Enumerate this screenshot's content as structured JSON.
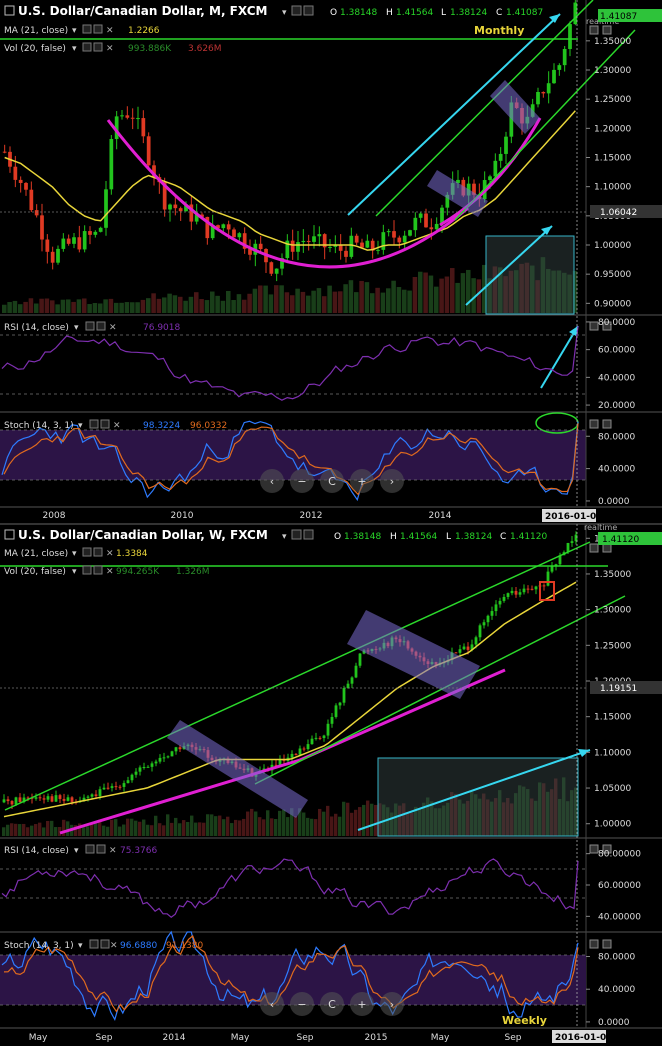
{
  "colors": {
    "background": "#000000",
    "bull": "#22c41d",
    "bear": "#e03a23",
    "ma": "#e8d53a",
    "rsi": "#7e2fb0",
    "stoch_k": "#2e7bff",
    "stoch_d": "#e06a1e",
    "magenta": "#e01fd2",
    "cyan": "#36d7f0",
    "channel": "#2bd82b",
    "box": "#7a6bd0",
    "panel_purple": "#2c1446",
    "price_tag": "#2ec33a"
  },
  "monthly": {
    "header": {
      "title": "U.S. Dollar/Canadian Dollar, M, FXCM",
      "o_label": "O",
      "o": "1.38148",
      "h_label": "H",
      "h": "1.41564",
      "l_label": "L",
      "l": "1.38124",
      "c_label": "C",
      "c": "1.41087"
    },
    "ma_label": "MA (21, close)",
    "ma_value": "1.2266",
    "vol_label": "Vol (20, false)",
    "vol_v1": "993.886K",
    "vol_v2": "3.626M",
    "annotation": "Monthly",
    "realtime": "realtime",
    "price_axis": [
      "1.40000",
      "1.35000",
      "1.30000",
      "1.25000",
      "1.20000",
      "1.15000",
      "1.10000",
      "1.05000",
      "1.00000",
      "0.95000",
      "0.90000"
    ],
    "price_tag": "1.41087",
    "crosshair_tag": "1.06042",
    "rsi_label": "RSI (14, close)",
    "rsi_value": "76.9018",
    "rsi_axis": [
      "80.0000",
      "60.0000",
      "40.0000",
      "20.0000"
    ],
    "stoch_label": "Stoch (14, 3, 1)",
    "stoch_k": "98.3224",
    "stoch_d": "96.0332",
    "stoch_axis": [
      "80.0000",
      "40.0000",
      "0.0000"
    ],
    "time_axis": [
      "2008",
      "2010",
      "2012",
      "2014"
    ],
    "date_tag": "2016-01-01"
  },
  "weekly": {
    "header": {
      "title": "U.S. Dollar/Canadian Dollar, W, FXCM",
      "o_label": "O",
      "o": "1.38148",
      "h_label": "H",
      "h": "1.41564",
      "l_label": "L",
      "l": "1.38124",
      "c_label": "C",
      "c": "1.41120"
    },
    "ma_label": "MA (21, close)",
    "ma_value": "1.3384",
    "vol_label": "Vol (20, false)",
    "vol_v1": "994.265K",
    "vol_v2": "1.326M",
    "annotation": "Weekly",
    "realtime": "realtime",
    "price_axis": [
      "1.40000",
      "1.35000",
      "1.30000",
      "1.25000",
      "1.20000",
      "1.15000",
      "1.10000",
      "1.05000",
      "1.00000"
    ],
    "price_tag": "1.41120",
    "crosshair_tag": "1.19151",
    "rsi_label": "RSI (14, close)",
    "rsi_value": "75.3766",
    "rsi_axis": [
      "80.00000",
      "60.00000",
      "40.00000"
    ],
    "stoch_label": "Stoch (14, 3, 1)",
    "stoch_k": "96.6880",
    "stoch_d": "91.1380",
    "stoch_axis": [
      "80.0000",
      "40.0000",
      "0.0000"
    ],
    "time_axis": [
      "May",
      "Sep",
      "2014",
      "May",
      "Sep",
      "2015",
      "May",
      "Sep"
    ],
    "date_tag": "2016-01-04"
  },
  "nav_buttons": [
    "‹",
    "−",
    "C",
    "+",
    "›"
  ],
  "chart_data": [
    {
      "type": "candlestick",
      "title": "U.S. Dollar/Canadian Dollar, M, FXCM",
      "xlabel": "",
      "ylabel": "",
      "ylim": [
        0.88,
        1.42
      ],
      "x": [
        "2007-01",
        "2007-04",
        "2007-07",
        "2007-10",
        "2008-01",
        "2008-04",
        "2008-07",
        "2008-10",
        "2009-01",
        "2009-04",
        "2009-07",
        "2009-10",
        "2010-01",
        "2010-04",
        "2010-07",
        "2010-10",
        "2011-01",
        "2011-04",
        "2011-07",
        "2011-10",
        "2012-01",
        "2012-04",
        "2012-07",
        "2012-10",
        "2013-01",
        "2013-04",
        "2013-07",
        "2013-10",
        "2014-01",
        "2014-04",
        "2014-07",
        "2014-10",
        "2015-01",
        "2015-04",
        "2015-07",
        "2015-10",
        "2015-12"
      ],
      "series": [
        {
          "name": "Close",
          "values": [
            1.16,
            1.11,
            1.05,
            0.98,
            1.0,
            1.01,
            1.02,
            1.22,
            1.23,
            1.16,
            1.08,
            1.06,
            1.05,
            1.02,
            1.04,
            1.01,
            0.99,
            0.96,
            1.0,
            1.01,
            1.0,
            0.99,
            1.0,
            0.99,
            1.01,
            1.02,
            1.04,
            1.04,
            1.09,
            1.1,
            1.09,
            1.13,
            1.24,
            1.21,
            1.27,
            1.31,
            1.41
          ]
        },
        {
          "name": "MA (21, close)",
          "values": [
            1.15,
            1.14,
            1.12,
            1.1,
            1.07,
            1.05,
            1.04,
            1.07,
            1.1,
            1.12,
            1.11,
            1.1,
            1.08,
            1.06,
            1.05,
            1.04,
            1.02,
            1.01,
            1.0,
            1.0,
            1.0,
            1.0,
            1.0,
            0.99,
            1.0,
            1.0,
            1.01,
            1.02,
            1.03,
            1.05,
            1.06,
            1.08,
            1.11,
            1.14,
            1.17,
            1.2,
            1.23
          ]
        }
      ],
      "indicators": {
        "rsi": 76.9018,
        "stoch_k": 98.3224,
        "stoch_d": 96.0332,
        "ma_last": 1.2266
      },
      "highlight_levels": [
        1.3717,
        1.06042
      ]
    },
    {
      "type": "candlestick",
      "title": "U.S. Dollar/Canadian Dollar, W, FXCM",
      "xlabel": "",
      "ylabel": "",
      "ylim": [
        0.98,
        1.42
      ],
      "x": [
        "2013-05",
        "2013-07",
        "2013-09",
        "2013-11",
        "2014-01",
        "2014-03",
        "2014-05",
        "2014-07",
        "2014-09",
        "2014-11",
        "2015-01",
        "2015-03",
        "2015-05",
        "2015-07",
        "2015-09",
        "2015-11",
        "2016-01"
      ],
      "series": [
        {
          "name": "Close",
          "values": [
            1.03,
            1.04,
            1.03,
            1.05,
            1.08,
            1.11,
            1.09,
            1.07,
            1.09,
            1.13,
            1.24,
            1.26,
            1.22,
            1.25,
            1.32,
            1.33,
            1.41
          ]
        },
        {
          "name": "MA (21, close)",
          "values": [
            1.01,
            1.02,
            1.03,
            1.04,
            1.05,
            1.07,
            1.09,
            1.09,
            1.09,
            1.11,
            1.15,
            1.19,
            1.22,
            1.24,
            1.28,
            1.31,
            1.3384
          ]
        }
      ],
      "indicators": {
        "rsi": 75.3766,
        "stoch_k": 96.688,
        "stoch_d": 91.138,
        "ma_last": 1.3384
      },
      "highlight_levels": [
        1.37,
        1.19151
      ]
    }
  ]
}
